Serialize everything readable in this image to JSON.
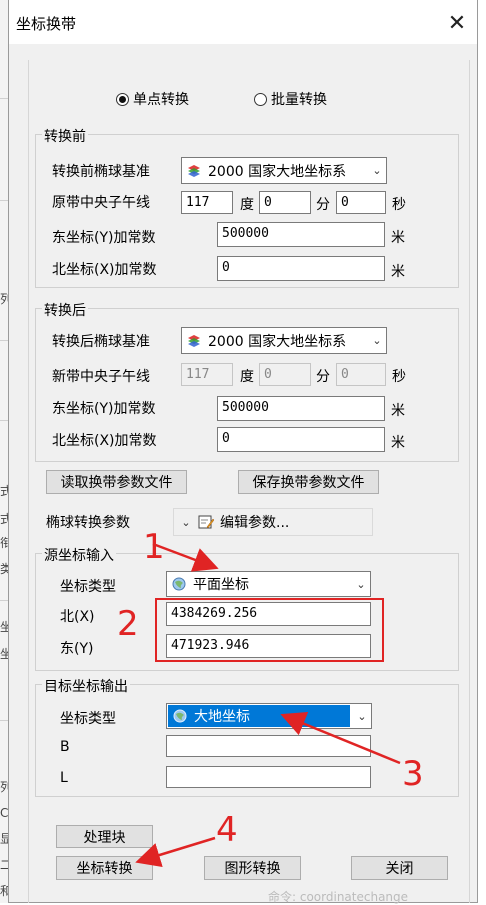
{
  "dialog": {
    "title": "坐标换带",
    "close_glyph": "✕"
  },
  "mode": {
    "single_label": "单点转换",
    "batch_label": "批量转换",
    "selected": "single"
  },
  "before": {
    "group_label": "转换前",
    "ellipsoid_label": "转换前椭球基准",
    "ellipsoid_value": "2000 国家大地坐标系",
    "meridian_label": "原带中央子午线",
    "deg_value": "117",
    "deg_unit": "度",
    "min_value": "0",
    "min_unit": "分",
    "sec_value": "0",
    "sec_unit": "秒",
    "east_label": "东坐标(Y)加常数",
    "east_value": "500000",
    "east_unit": "米",
    "north_label": "北坐标(X)加常数",
    "north_value": "0",
    "north_unit": "米"
  },
  "after": {
    "group_label": "转换后",
    "ellipsoid_label": "转换后椭球基准",
    "ellipsoid_value": "2000 国家大地坐标系",
    "meridian_label": "新带中央子午线",
    "deg_value": "117",
    "deg_unit": "度",
    "min_value": "0",
    "min_unit": "分",
    "sec_value": "0",
    "sec_unit": "秒",
    "east_label": "东坐标(Y)加常数",
    "east_value": "500000",
    "east_unit": "米",
    "north_label": "北坐标(X)加常数",
    "north_value": "0",
    "north_unit": "米"
  },
  "params": {
    "read_button": "读取换带参数文件",
    "save_button": "保存换带参数文件",
    "ellipsoid_transform_label": "椭球转换参数",
    "edit_params": "编辑参数..."
  },
  "source": {
    "group_label": "源坐标输入",
    "type_label": "坐标类型",
    "type_value": "平面坐标",
    "north_label": "北(X)",
    "north_value": "4384269.256",
    "east_label": "东(Y)",
    "east_value": "471923.946"
  },
  "target": {
    "group_label": "目标坐标输出",
    "type_label": "坐标类型",
    "type_value": "大地坐标",
    "b_label": "B",
    "b_value": "",
    "l_label": "L",
    "l_value": ""
  },
  "actions": {
    "process_block": "处理块",
    "coord_convert": "坐标转换",
    "graphic_convert": "图形转换",
    "close": "关闭"
  },
  "annotations": {
    "n1": "1",
    "n2": "2",
    "n3": "3",
    "n4": "4"
  },
  "background": {
    "side_chars": [
      "列",
      "式",
      "式",
      "衔",
      "类",
      "坐",
      "坐",
      "列",
      "C",
      "显",
      "二",
      "和"
    ],
    "bottom_text": "命令: coordinatechange"
  },
  "colors": {
    "annotation_red": "#e02424",
    "selection_blue": "#0078d7"
  }
}
